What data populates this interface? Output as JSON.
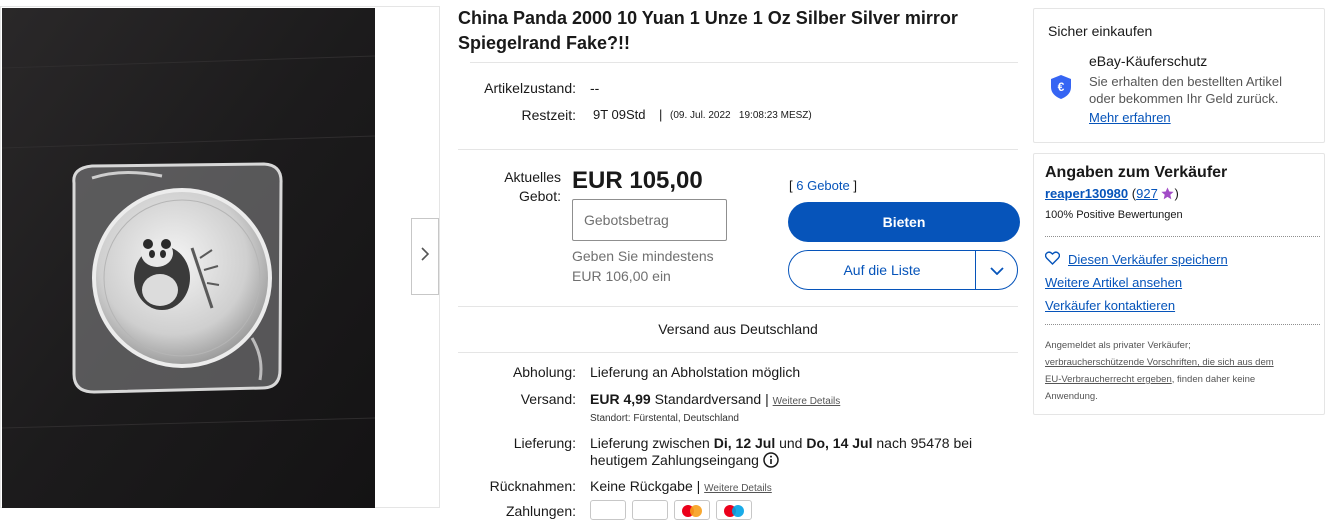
{
  "listing": {
    "title": "China Panda 2000 10 Yuan 1 Unze 1 Oz Silber Silver mirror Spiegelrand Fake?!!",
    "condition_label": "Artikelzustand:",
    "condition_value": "--",
    "time_label": "Restzeit:",
    "time_left": "9T 09Std",
    "time_sep": "|",
    "end_time": "(09. Jul. 2022   19:08:23 MESZ)"
  },
  "bid": {
    "current_label_line1": "Aktuelles",
    "current_label_line2": "Gebot:",
    "price": "EUR 105,00",
    "bids_open": "[",
    "bids_link": "6 Gebote",
    "bids_close": "]",
    "input_placeholder": "Gebotsbetrag",
    "min_hint_line1": "Geben Sie mindestens",
    "min_hint_line2": "EUR 106,00 ein",
    "bid_button": "Bieten",
    "watch_button": "Auf die Liste"
  },
  "shipping": {
    "ships_from": "Versand aus Deutschland",
    "pickup_label": "Abholung:",
    "pickup_value": "Lieferung an Abholstation möglich",
    "shipping_label": "Versand:",
    "shipping_price": "EUR 4,99",
    "shipping_type": "Standardversand |",
    "shipping_details_link": "Weitere Details",
    "location": "Standort: Fürstental, Deutschland",
    "delivery_label": "Lieferung:",
    "delivery_pre": "Lieferung zwischen",
    "delivery_date1": "Di, 12 Jul",
    "delivery_und": "und",
    "delivery_date2": "Do, 14 Jul",
    "delivery_post": "nach 95478 bei",
    "delivery_line2": "heutigem Zahlungseingang",
    "returns_label": "Rücknahmen:",
    "returns_value": "Keine Rückgabe |",
    "returns_details_link": "Weitere Details",
    "payment_label": "Zahlungen:"
  },
  "protection": {
    "heading": "Sicher einkaufen",
    "title": "eBay-Käuferschutz",
    "text_line1": "Sie erhalten den bestellten Artikel",
    "text_line2": "oder bekommen Ihr Geld zurück.",
    "link": "Mehr erfahren"
  },
  "seller": {
    "heading": "Angaben zum Verkäufer",
    "name": "reaper130980",
    "score_open": "(",
    "score": "927",
    "score_close": ")",
    "feedback": "100% Positive Bewertungen",
    "save_link": "Diesen Verkäufer speichern",
    "more_items_link": "Weitere Artikel ansehen",
    "contact_link": "Verkäufer kontaktieren",
    "note_line1": "Angemeldet als privater Verkäufer;",
    "note_link1": "verbraucherschützende Vorschriften, die sich aus dem",
    "note_link2": "EU-Verbraucherrecht ergeben",
    "note_post": ", finden daher keine",
    "note_line4": "Anwendung."
  },
  "colors": {
    "brand_blue": "#0654ba",
    "text": "#191919",
    "border": "#e5e5e5",
    "star": "#a24cc7"
  },
  "icons": [
    "chevron-right-icon",
    "chevron-down-icon",
    "shield-euro-icon",
    "heart-icon",
    "star-icon",
    "info-icon"
  ]
}
